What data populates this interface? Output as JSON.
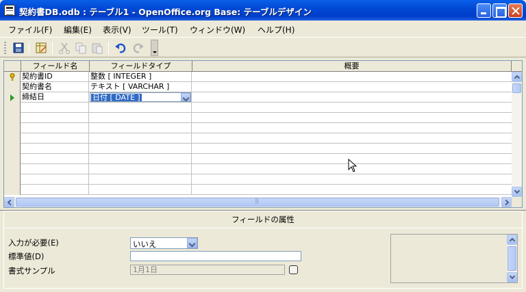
{
  "window": {
    "title": "契約書DB.odb : テーブル1 - OpenOffice.org Base: テーブルデザイン"
  },
  "menu": {
    "items": [
      "ファイル(F)",
      "編集(E)",
      "表示(V)",
      "ツール(T)",
      "ウィンドウ(W)",
      "ヘルプ(H)"
    ]
  },
  "toolbar": {
    "buttons": [
      "save-icon",
      "table-edit-icon",
      "cut-icon",
      "copy-icon",
      "paste-icon",
      "undo-icon",
      "redo-icon"
    ]
  },
  "table": {
    "headers": [
      "フィールド名",
      "フィールドタイプ",
      "概要"
    ],
    "rows": [
      {
        "name": "契約書ID",
        "type": "整数 [ INTEGER ]",
        "primary_key": true
      },
      {
        "name": "契約書名",
        "type": "テキスト [ VARCHAR ]"
      },
      {
        "name": "締結日",
        "type": "日付 [ DATE ]",
        "current": true
      }
    ]
  },
  "properties": {
    "title": "フィールドの属性",
    "required_label": "入力が必要(E)",
    "required_value": "いいえ",
    "default_label": "標準値(D)",
    "default_value": "",
    "format_label": "書式サンプル",
    "format_value": "1月1日"
  }
}
